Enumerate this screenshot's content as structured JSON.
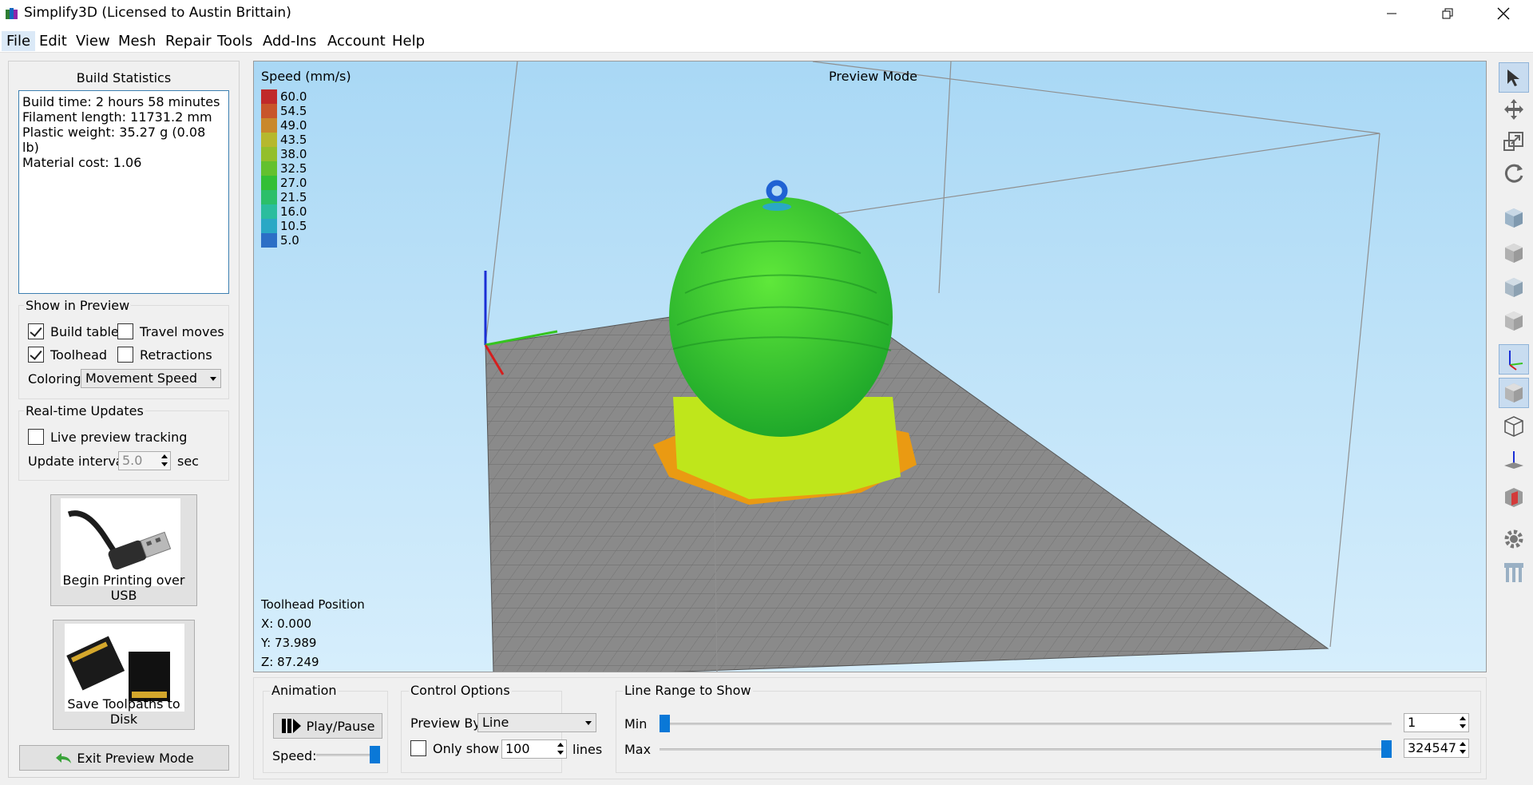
{
  "window": {
    "title": "Simplify3D (Licensed to Austin Brittain)"
  },
  "menu": [
    "File",
    "Edit",
    "View",
    "Mesh",
    "Repair",
    "Tools",
    "Add-Ins",
    "Account",
    "Help"
  ],
  "build_statistics": {
    "title": "Build Statistics",
    "lines": [
      "Build time: 2 hours 58 minutes",
      "Filament length: 11731.2 mm",
      "Plastic weight: 35.27 g (0.08 lb)",
      "Material cost: 1.06"
    ]
  },
  "show_in_preview": {
    "title": "Show in Preview",
    "build_table": {
      "label": "Build table",
      "checked": true
    },
    "travel_moves": {
      "label": "Travel moves",
      "checked": false
    },
    "toolhead": {
      "label": "Toolhead",
      "checked": true
    },
    "retractions": {
      "label": "Retractions",
      "checked": false
    },
    "coloring_label": "Coloring",
    "coloring_value": "Movement Speed"
  },
  "realtime_updates": {
    "title": "Real-time Updates",
    "live_preview": {
      "label": "Live preview tracking",
      "checked": false
    },
    "interval_label": "Update interval",
    "interval_value": "5.0",
    "interval_unit": "sec"
  },
  "buttons": {
    "usb": "Begin Printing over USB",
    "disk": "Save Toolpaths to Disk",
    "exit": "Exit Preview Mode"
  },
  "viewport": {
    "legend_title": "Speed (mm/s)",
    "legend": [
      {
        "label": "60.0",
        "color": "#c0292a"
      },
      {
        "label": "54.5",
        "color": "#c8552b"
      },
      {
        "label": "49.0",
        "color": "#c9882c"
      },
      {
        "label": "43.5",
        "color": "#b6b82d"
      },
      {
        "label": "38.0",
        "color": "#93bf2c"
      },
      {
        "label": "32.5",
        "color": "#63c12e"
      },
      {
        "label": "27.0",
        "color": "#33bf36"
      },
      {
        "label": "21.5",
        "color": "#2cbf6a"
      },
      {
        "label": "16.0",
        "color": "#2bbd9e"
      },
      {
        "label": "10.5",
        "color": "#2aa8c5"
      },
      {
        "label": "5.0",
        "color": "#2c6fc6"
      }
    ],
    "mode_label": "Preview Mode",
    "toolhead_title": "Toolhead Position",
    "x": "X: 0.000",
    "y": "Y: 73.989",
    "z": "Z: 87.249"
  },
  "animation": {
    "title": "Animation",
    "play_label": "Play/Pause",
    "speed_label": "Speed:",
    "speed_level": 1.0
  },
  "control_options": {
    "title": "Control Options",
    "preview_by_label": "Preview By",
    "preview_by_value": "Line",
    "only_show_label": "Only show",
    "only_show_checked": false,
    "only_show_value": "100",
    "only_show_unit": "lines"
  },
  "line_range": {
    "title": "Line Range to Show",
    "min_label": "Min",
    "max_label": "Max",
    "min_value": "1",
    "max_value": "324547",
    "min_level": 0.0,
    "max_level": 1.0
  }
}
